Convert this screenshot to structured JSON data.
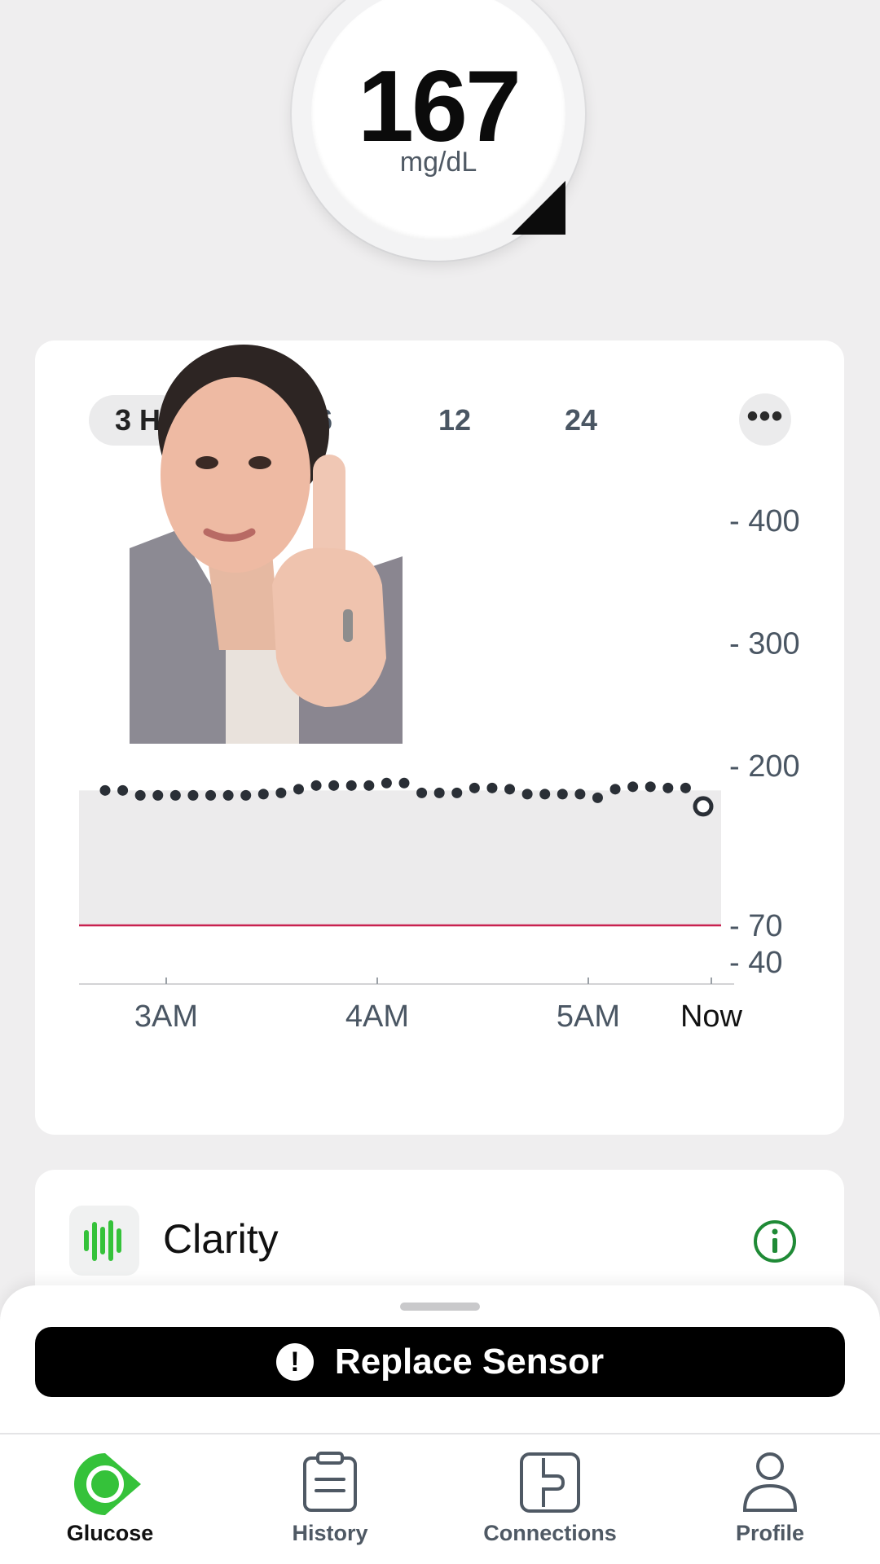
{
  "reading": {
    "value": "167",
    "unit": "mg/dL"
  },
  "chart_card": {
    "ranges": [
      "3 H",
      "6",
      "12",
      "24"
    ],
    "selected_range": "3 H",
    "more_label": "•••"
  },
  "chart_data": {
    "type": "scatter",
    "x_ticks": [
      "3AM",
      "4AM",
      "5AM",
      "Now"
    ],
    "y_ticks": [
      "400",
      "300",
      "200",
      "70",
      "40"
    ],
    "target_range": [
      70,
      180
    ],
    "low_threshold": 70,
    "series": [
      {
        "values": [
          180,
          180,
          176,
          176,
          176,
          176,
          176,
          176,
          176,
          177,
          178,
          181,
          184,
          184,
          184,
          184,
          186,
          186,
          178,
          178,
          178,
          182,
          182,
          181,
          177,
          177,
          177,
          177,
          174,
          181,
          183,
          183,
          182,
          182,
          167
        ]
      }
    ]
  },
  "clarity": {
    "label": "Clarity"
  },
  "bottom_sheet": {
    "replace_label": "Replace Sensor",
    "alert_glyph": "!"
  },
  "tabs": [
    {
      "label": "Glucose",
      "icon": "glucose-drop-icon",
      "active": true
    },
    {
      "label": "History",
      "icon": "clipboard-icon",
      "active": false
    },
    {
      "label": "Connections",
      "icon": "connections-icon",
      "active": false
    },
    {
      "label": "Profile",
      "icon": "person-icon",
      "active": false
    }
  ],
  "colors": {
    "accent_green": "#35c23a",
    "low_line": "#c8214f",
    "dot": "#2a2f36",
    "band": "#ecebec"
  }
}
